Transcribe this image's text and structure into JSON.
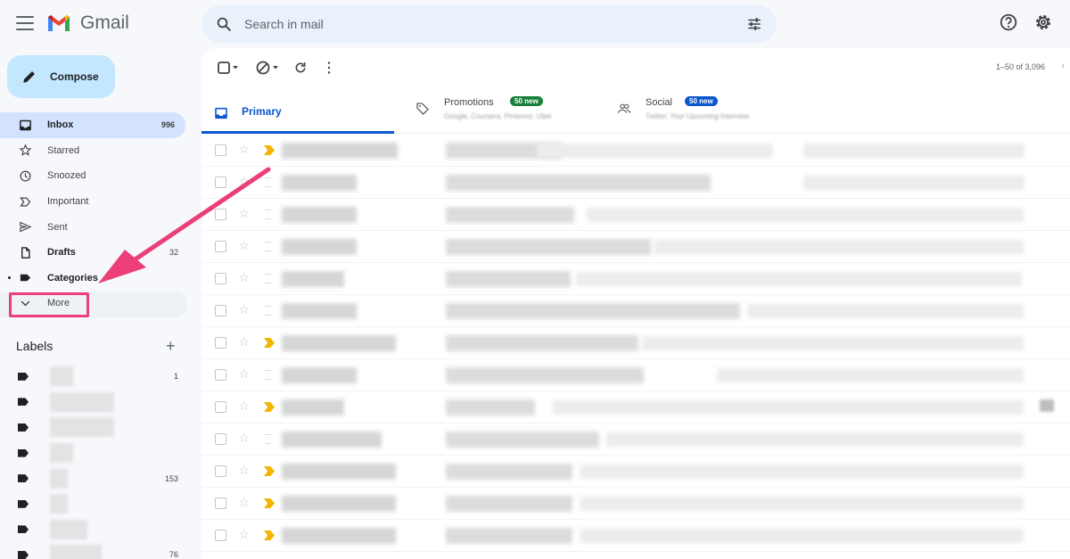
{
  "app": {
    "name": "Gmail"
  },
  "search": {
    "placeholder": "Search in mail"
  },
  "compose": {
    "label": "Compose"
  },
  "nav": [
    {
      "key": "inbox",
      "label": "Inbox",
      "count": "996",
      "icon": "inbox-icon",
      "active": true
    },
    {
      "key": "starred",
      "label": "Starred",
      "count": "",
      "icon": "star-icon"
    },
    {
      "key": "snoozed",
      "label": "Snoozed",
      "count": "",
      "icon": "clock-icon"
    },
    {
      "key": "important",
      "label": "Important",
      "count": "",
      "icon": "label-important-icon"
    },
    {
      "key": "sent",
      "label": "Sent",
      "count": "",
      "icon": "send-icon"
    },
    {
      "key": "drafts",
      "label": "Drafts",
      "count": "32",
      "icon": "draft-icon"
    },
    {
      "key": "categories",
      "label": "Categories",
      "count": "",
      "icon": "label-icon"
    },
    {
      "key": "more",
      "label": "More",
      "count": "",
      "icon": "chevron-down-icon"
    }
  ],
  "labels": {
    "heading": "Labels",
    "add": "+",
    "items": [
      {
        "count": "1"
      },
      {
        "count": ""
      },
      {
        "count": ""
      },
      {
        "count": ""
      },
      {
        "count": "153"
      },
      {
        "count": ""
      },
      {
        "count": ""
      },
      {
        "count": "76"
      }
    ]
  },
  "toolbar": {
    "pagination": "1–50 of 3,096"
  },
  "tabs": {
    "primary": {
      "label": "Primary"
    },
    "promotions": {
      "label": "Promotions",
      "badge": "50 new",
      "badge_color": "#188038",
      "sub": "Google, Coursera, Pinterest, Uber"
    },
    "social": {
      "label": "Social",
      "badge": "50 new",
      "badge_color": "#0b57d0",
      "sub": "Twitter, Your Upcoming Interview"
    }
  },
  "colors": {
    "accent": "#0b57d0",
    "highlight": "#ec3f78",
    "compose_bg": "#c2e7ff",
    "important": "#f2b600"
  }
}
